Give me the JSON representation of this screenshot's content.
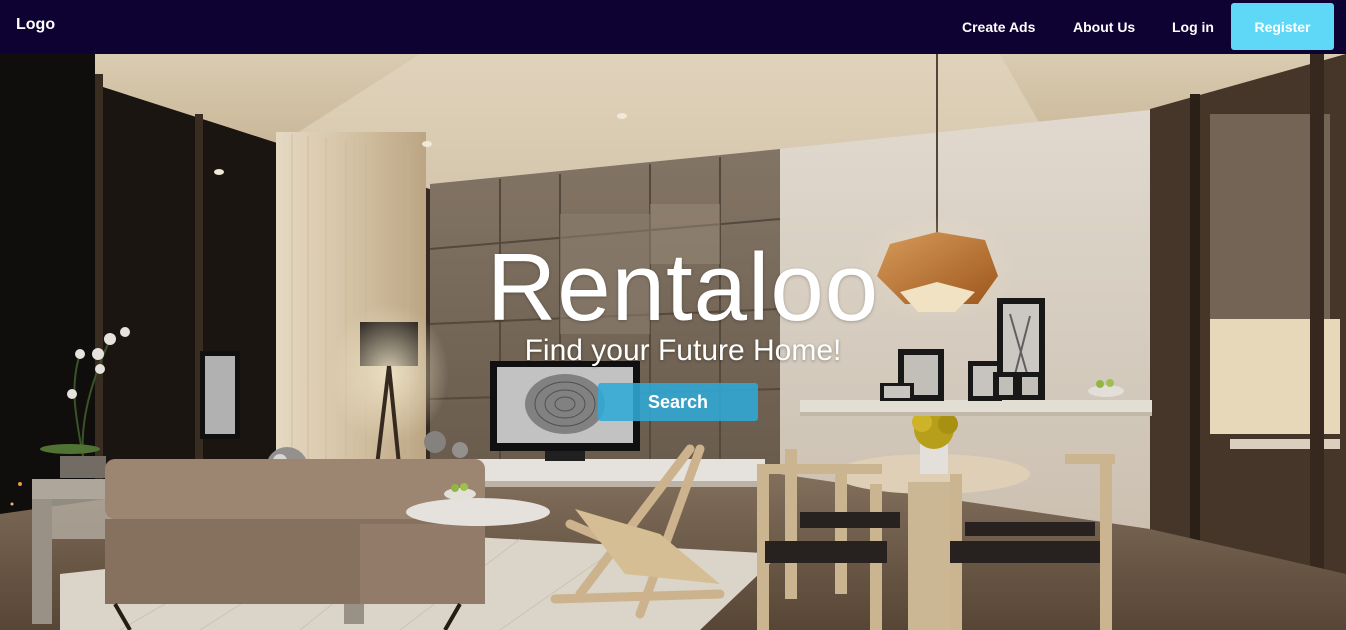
{
  "navbar": {
    "logo": "Logo",
    "links": {
      "create_ads": "Create Ads",
      "about_us": "About Us",
      "log_in": "Log in"
    },
    "register": "Register"
  },
  "hero": {
    "title": "Rentaloo",
    "subtitle": "Find your Future Home!",
    "search_button": "Search"
  },
  "colors": {
    "navbar_bg": "#0e0233",
    "register_bg": "#5fd8f7",
    "search_bg": "#2fa8d6"
  },
  "icons": [
    "pendant-lamp",
    "floor-lamp",
    "tv",
    "plant",
    "chair"
  ]
}
